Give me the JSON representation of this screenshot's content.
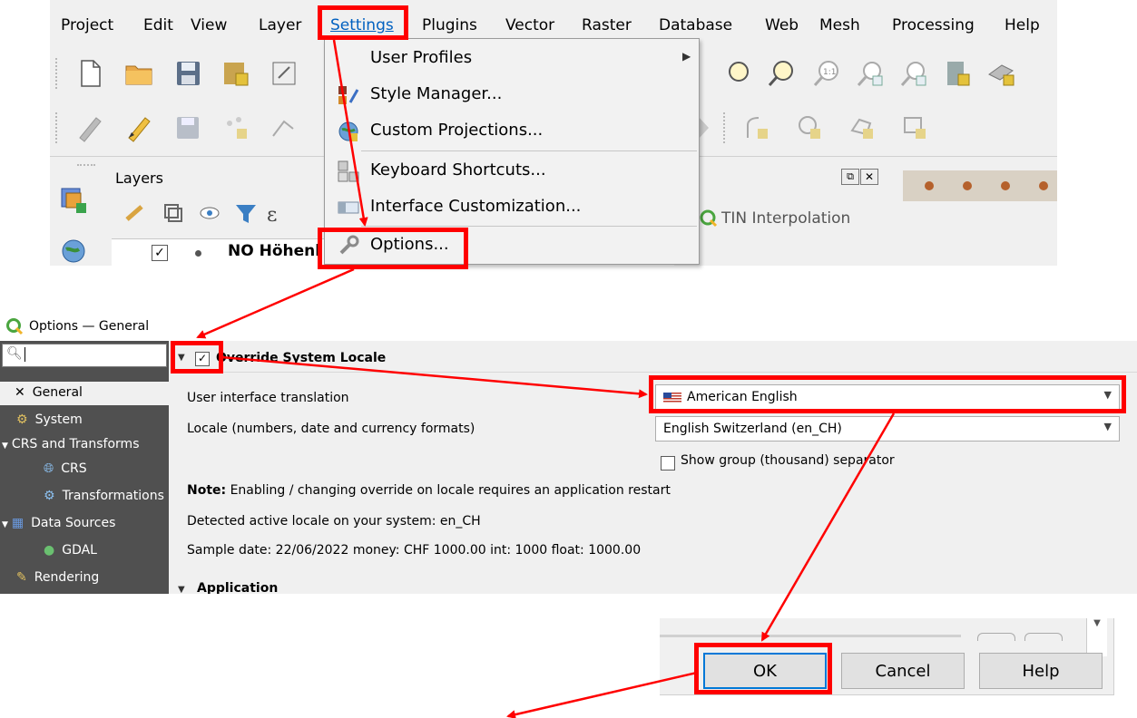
{
  "menubar": {
    "items": [
      "Project",
      "Edit",
      "View",
      "Layer",
      "Settings",
      "Plugins",
      "Vector",
      "Raster",
      "Database",
      "Web",
      "Mesh",
      "Processing",
      "Help"
    ]
  },
  "settings_menu": {
    "items": [
      {
        "label": "User Profiles",
        "icon": "none",
        "has_submenu": true
      },
      {
        "label": "Style Manager...",
        "icon": "style-manager-icon"
      },
      {
        "label": "Custom Projections...",
        "icon": "globe-icon"
      },
      {
        "label": "Keyboard Shortcuts...",
        "icon": "keyboard-shortcuts-icon"
      },
      {
        "label": "Interface Customization...",
        "icon": "interface-customization-icon"
      },
      {
        "label": "Options...",
        "icon": "wrench-icon"
      }
    ]
  },
  "layers_panel": {
    "title": "Layers",
    "row_label": "NO Höhenl",
    "tin_label": "TIN Interpolation"
  },
  "options_dialog": {
    "title": "Options — General",
    "search_value": "",
    "sidebar": [
      {
        "label": "General",
        "selected": true
      },
      {
        "label": "System"
      },
      {
        "label": "CRS and Transforms",
        "group": true
      },
      {
        "label": "CRS"
      },
      {
        "label": "Transformations"
      },
      {
        "label": "Data Sources",
        "group": true
      },
      {
        "label": "GDAL"
      },
      {
        "label": "Rendering"
      }
    ],
    "section_title": "Override System Locale",
    "section_checked": true,
    "ui_translation_label": "User interface translation",
    "ui_translation_value": "American English",
    "locale_label": "Locale (numbers, date and currency formats)",
    "locale_value": "English Switzerland (en_CH)",
    "group_separator_label": "Show group (thousand) separator",
    "note_bold": "Note:",
    "note_text": " Enabling / changing override on locale requires an application restart",
    "detected_locale": "Detected active locale on your system: en_CH",
    "sample": "Sample date: 22/06/2022 money: CHF 1000.00 int: 1000 float: 1000.00",
    "next_section": "Application"
  },
  "buttons": {
    "ok": "OK",
    "cancel": "Cancel",
    "help": "Help"
  },
  "colors": {
    "highlight": "#ff0000",
    "sidebar_bg": "#505050",
    "menu_selected": "#0078d7"
  }
}
